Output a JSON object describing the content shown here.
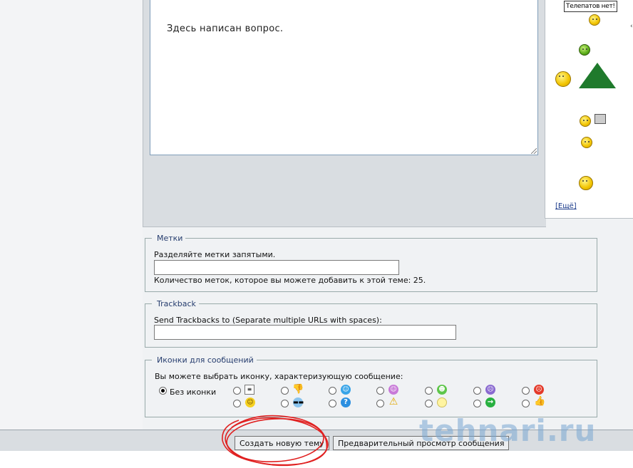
{
  "editor": {
    "message_text": "Здесь написан вопрос."
  },
  "smilies": {
    "tooltip": "Телепатов нет!",
    "more_open": "[",
    "more_link": "Ещё",
    "more_close": "]"
  },
  "tags": {
    "legend": "Метки",
    "hint": "Разделяйте метки запятыми.",
    "value": "",
    "count_note": "Количество меток, которое вы можете добавить к этой теме: 25."
  },
  "trackback": {
    "legend": "Trackback",
    "label": "Send Trackbacks to (Separate multiple URLs with spaces):",
    "value": ""
  },
  "post_icons": {
    "legend": "Иконки для сообщений",
    "description": "Вы можете выбрать иконку, характеризующую сообщение:",
    "no_icon_label": "Без иконки",
    "selected": "no-icon",
    "icons_row1": [
      "document",
      "thumbs-down",
      "smile-blue",
      "smile-purple",
      "grin",
      "sad-purple",
      "angry-red"
    ],
    "icons_row2": [
      "smile-yellow",
      "cool",
      "question",
      "warning",
      "lightbulb",
      "arrow-right",
      "thumbs-up"
    ]
  },
  "actions": {
    "submit_label": "Создать новую тему",
    "preview_label": "Предварительный просмотр сообщения"
  },
  "watermark": "tehnari.ru",
  "colors": {
    "legend_text": "#263d6e",
    "link": "#1a3a8a",
    "annotation_circle": "#e02020"
  }
}
